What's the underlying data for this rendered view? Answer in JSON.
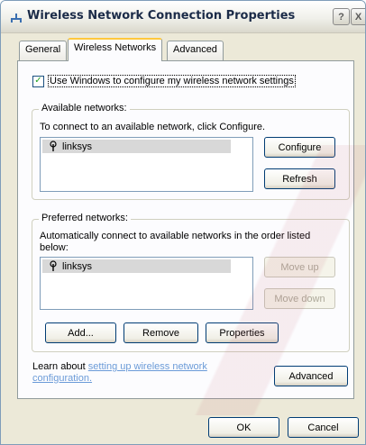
{
  "window": {
    "title": "Wireless Network Connection Properties",
    "help_label": "?",
    "close_label": "X"
  },
  "tabs": [
    {
      "label": "General",
      "active": false
    },
    {
      "label": "Wireless Networks",
      "active": true
    },
    {
      "label": "Advanced",
      "active": false
    }
  ],
  "use_windows_setting": {
    "label": "Use Windows to configure my wireless network settings",
    "checked": true,
    "check_glyph": "✓"
  },
  "available_networks": {
    "legend": "Available networks:",
    "description": "To connect to an available network, click Configure.",
    "items": [
      {
        "name": "linksys",
        "icon": "antenna-icon"
      }
    ],
    "configure_label": "Configure",
    "refresh_label": "Refresh"
  },
  "preferred_networks": {
    "legend": "Preferred networks:",
    "description": "Automatically connect to available networks in the order listed below:",
    "items": [
      {
        "name": "linksys",
        "icon": "antenna-icon"
      }
    ],
    "move_up_label": "Move up",
    "move_down_label": "Move down",
    "add_label": "Add...",
    "remove_label": "Remove",
    "properties_label": "Properties"
  },
  "learn": {
    "prefix": "Learn about ",
    "link": "setting up wireless network configuration."
  },
  "advanced_button_label": "Advanced",
  "footer": {
    "ok_label": "OK",
    "cancel_label": "Cancel"
  },
  "colors": {
    "dialog_bg": "#ece9d8",
    "panel_bg": "#fcfcfe",
    "link": "#6b9bd8",
    "selected_item": "#d8d8d8"
  }
}
